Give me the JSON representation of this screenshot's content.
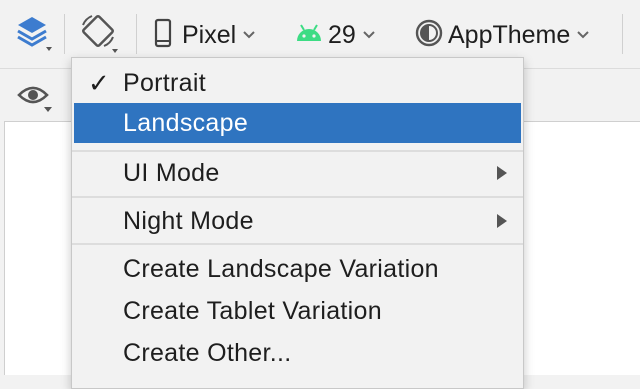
{
  "toolbar": {
    "device_label": "Pixel",
    "api_label": "29",
    "theme_label": "AppTheme"
  },
  "menu": {
    "items": [
      {
        "label": "Portrait",
        "checked": true
      },
      {
        "label": "Landscape",
        "selected": true
      },
      {
        "label": "UI Mode",
        "submenu": true
      },
      {
        "label": "Night Mode",
        "submenu": true
      },
      {
        "label": "Create Landscape Variation"
      },
      {
        "label": "Create Tablet Variation"
      },
      {
        "label": "Create Other..."
      }
    ],
    "check_glyph": "✓"
  },
  "colors": {
    "selection": "#2f74c0",
    "android_green": "#3ddc84",
    "layers_blue": "#3d7ccf"
  },
  "icons": [
    "layers-icon",
    "orientation-icon",
    "phone-icon",
    "android-icon",
    "theme-icon",
    "eye-icon",
    "chevron-down-icon",
    "submenu-arrow-icon"
  ]
}
